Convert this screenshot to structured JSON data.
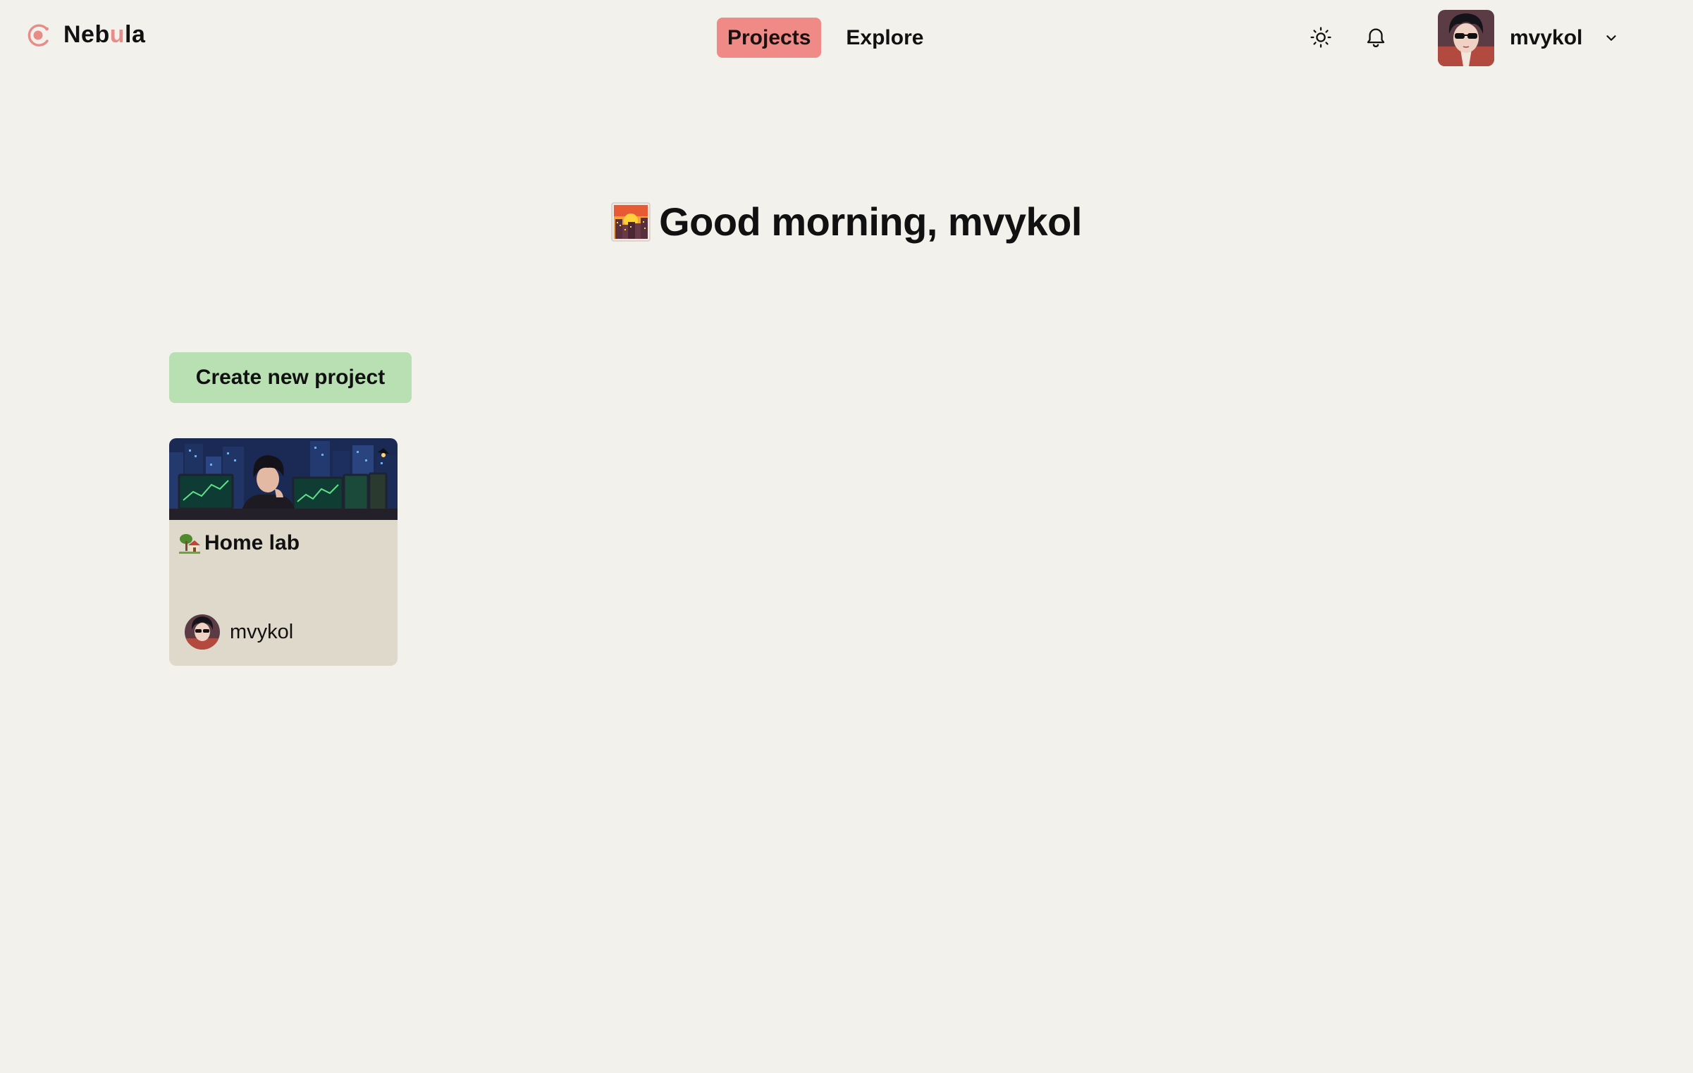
{
  "brand": {
    "name_prefix": "Neb",
    "name_accent": "u",
    "name_suffix": "la",
    "logo_icon": "nebula-logo-icon",
    "accent_color": "#e98b86"
  },
  "nav": {
    "tabs": [
      {
        "label": "Projects",
        "active": true
      },
      {
        "label": "Explore",
        "active": false
      }
    ],
    "active_color": "#f08a86"
  },
  "header": {
    "theme_toggle_icon": "sun-icon",
    "notifications_icon": "bell-icon",
    "user": {
      "name": "mvykol",
      "avatar_icon": "avatar",
      "menu_icon": "chevron-down-icon"
    }
  },
  "greeting": {
    "emoji_icon": "city-sunrise-icon",
    "text": "Good morning, mvykol"
  },
  "actions": {
    "create_label": "Create new project",
    "create_color": "#b8e0b3"
  },
  "projects": [
    {
      "title": "Home lab",
      "title_emoji_icon": "house-with-garden-icon",
      "cover_icon": "project-cover-image",
      "owner": "mvykol",
      "card_color": "#dfd9cb"
    }
  ]
}
